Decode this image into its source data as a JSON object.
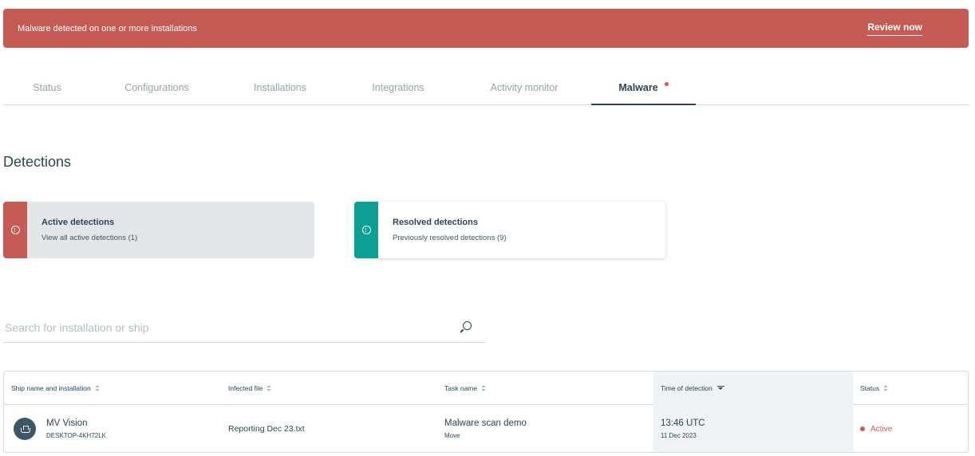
{
  "alert": {
    "message": "Malware detected on one or more installations",
    "action_label": "Review now"
  },
  "tabs": [
    {
      "label": "Status"
    },
    {
      "label": "Configurations"
    },
    {
      "label": "Installations"
    },
    {
      "label": "Integrations"
    },
    {
      "label": "Activity monitor"
    },
    {
      "label": "Malware"
    }
  ],
  "section": {
    "title": "Detections"
  },
  "cards": {
    "active": {
      "title": "Active detections",
      "subtitle": "View all active detections (1)"
    },
    "resolved": {
      "title": "Resolved detections",
      "subtitle": "Previously resolved detections (9)"
    }
  },
  "search": {
    "placeholder": "Search for installation or ship",
    "value": ""
  },
  "table": {
    "columns": [
      {
        "label": "Ship name and installation"
      },
      {
        "label": "Infected file"
      },
      {
        "label": "Task name"
      },
      {
        "label": "Time of detection"
      },
      {
        "label": "Status"
      }
    ],
    "rows": [
      {
        "ship": "MV Vision",
        "installation": "DESKTOP-4KH72LK",
        "file": "Reporting Dec 23.txt",
        "task": "Malware scan demo",
        "task_action": "Move",
        "time": "13:46 UTC",
        "date": "11 Dec 2023",
        "status": "Active"
      }
    ]
  },
  "colors": {
    "alert": "#c65b54",
    "active_stripe": "#c65b54",
    "resolved_stripe": "#0d9f94",
    "text_dark": "#2b4654",
    "status_active": "#c65b54"
  },
  "icons": {
    "card_active": "alert-circle-icon",
    "card_resolved": "alert-circle-icon",
    "search": "search-icon",
    "avatar": "ship-icon",
    "sort": "sort-icon"
  }
}
